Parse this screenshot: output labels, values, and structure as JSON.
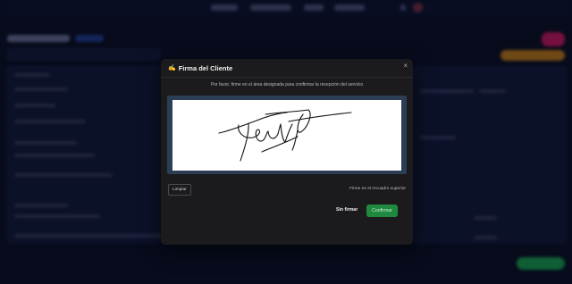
{
  "modal": {
    "title": "Firma del Cliente",
    "title_icon": "writing-hand-icon",
    "close_label": "×",
    "description": "Por favor, firme en el área designada para confirmar la recepción del servicio",
    "clear_label": "Limpiar",
    "hint": "Firme en el recuadro superior",
    "skip_label": "Sin firmar",
    "confirm_label": "Confirmar"
  },
  "colors": {
    "modal_bg": "#1b1b1d",
    "signature_frame": "#2c3e55",
    "confirm_green": "#1f8a3f",
    "accent_pink": "#d0155c",
    "accent_orange": "#c77a10"
  }
}
